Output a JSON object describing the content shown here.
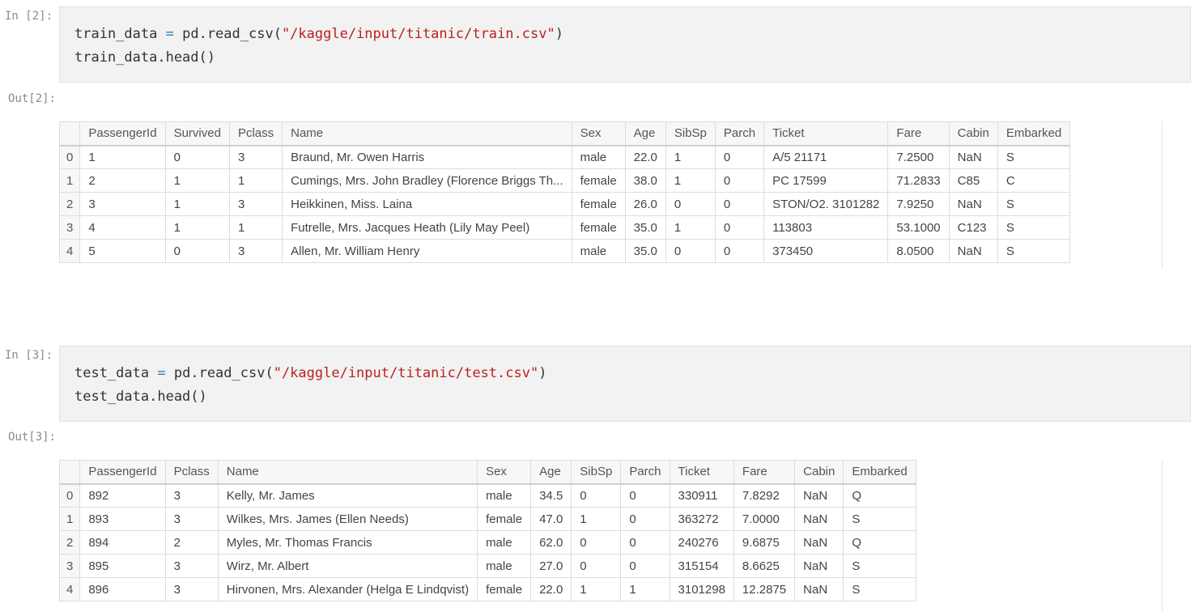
{
  "cells": [
    {
      "in_prompt": "In [2]:",
      "out_prompt": "Out[2]:",
      "code": [
        {
          "var": "train_data",
          "op": "=",
          "call": "pd.read_csv(",
          "str": "\"/kaggle/input/titanic/train.csv\"",
          "close": ")"
        },
        {
          "line": "train_data.head()"
        }
      ],
      "table": {
        "columns": [
          "",
          "PassengerId",
          "Survived",
          "Pclass",
          "Name",
          "Sex",
          "Age",
          "SibSp",
          "Parch",
          "Ticket",
          "Fare",
          "Cabin",
          "Embarked"
        ],
        "rows": [
          [
            "0",
            "1",
            "0",
            "3",
            "Braund, Mr. Owen Harris",
            "male",
            "22.0",
            "1",
            "0",
            "A/5 21171",
            "7.2500",
            "NaN",
            "S"
          ],
          [
            "1",
            "2",
            "1",
            "1",
            "Cumings, Mrs. John Bradley (Florence Briggs Th...",
            "female",
            "38.0",
            "1",
            "0",
            "PC 17599",
            "71.2833",
            "C85",
            "C"
          ],
          [
            "2",
            "3",
            "1",
            "3",
            "Heikkinen, Miss. Laina",
            "female",
            "26.0",
            "0",
            "0",
            "STON/O2. 3101282",
            "7.9250",
            "NaN",
            "S"
          ],
          [
            "3",
            "4",
            "1",
            "1",
            "Futrelle, Mrs. Jacques Heath (Lily May Peel)",
            "female",
            "35.0",
            "1",
            "0",
            "113803",
            "53.1000",
            "C123",
            "S"
          ],
          [
            "4",
            "5",
            "0",
            "3",
            "Allen, Mr. William Henry",
            "male",
            "35.0",
            "0",
            "0",
            "373450",
            "8.0500",
            "NaN",
            "S"
          ]
        ]
      }
    },
    {
      "in_prompt": "In [3]:",
      "out_prompt": "Out[3]:",
      "code": [
        {
          "var": "test_data",
          "op": "=",
          "call": "pd.read_csv(",
          "str": "\"/kaggle/input/titanic/test.csv\"",
          "close": ")"
        },
        {
          "line": "test_data.head()"
        }
      ],
      "table": {
        "columns": [
          "",
          "PassengerId",
          "Pclass",
          "Name",
          "Sex",
          "Age",
          "SibSp",
          "Parch",
          "Ticket",
          "Fare",
          "Cabin",
          "Embarked"
        ],
        "rows": [
          [
            "0",
            "892",
            "3",
            "Kelly, Mr. James",
            "male",
            "34.5",
            "0",
            "0",
            "330911",
            "7.8292",
            "NaN",
            "Q"
          ],
          [
            "1",
            "893",
            "3",
            "Wilkes, Mrs. James (Ellen Needs)",
            "female",
            "47.0",
            "1",
            "0",
            "363272",
            "7.0000",
            "NaN",
            "S"
          ],
          [
            "2",
            "894",
            "2",
            "Myles, Mr. Thomas Francis",
            "male",
            "62.0",
            "0",
            "0",
            "240276",
            "9.6875",
            "NaN",
            "Q"
          ],
          [
            "3",
            "895",
            "3",
            "Wirz, Mr. Albert",
            "male",
            "27.0",
            "0",
            "0",
            "315154",
            "8.6625",
            "NaN",
            "S"
          ],
          [
            "4",
            "896",
            "3",
            "Hirvonen, Mrs. Alexander (Helga E Lindqvist)",
            "female",
            "22.0",
            "1",
            "1",
            "3101298",
            "12.2875",
            "NaN",
            "S"
          ]
        ]
      }
    }
  ]
}
